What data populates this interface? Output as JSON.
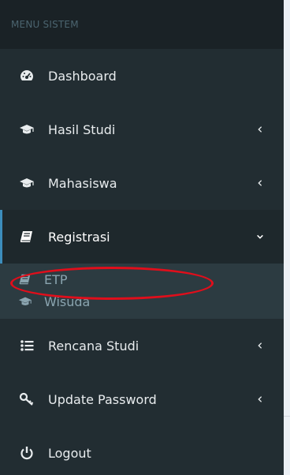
{
  "sidebar": {
    "header": "MENU SISTEM",
    "items": [
      {
        "label": "Dashboard",
        "icon": "dashboard-icon"
      },
      {
        "label": "Hasil Studi",
        "icon": "graduation-cap-icon",
        "chevron": "chevron-left-icon"
      },
      {
        "label": "Mahasiswa",
        "icon": "graduation-cap-icon",
        "chevron": "chevron-left-icon"
      },
      {
        "label": "Registrasi",
        "icon": "book-icon",
        "chevron": "chevron-down-icon",
        "expanded": true
      },
      {
        "label": "Rencana Studi",
        "icon": "list-icon",
        "chevron": "chevron-left-icon"
      },
      {
        "label": "Update Password",
        "icon": "key-icon",
        "chevron": "chevron-left-icon"
      },
      {
        "label": "Logout",
        "icon": "power-icon"
      }
    ],
    "registrasi_submenu": [
      {
        "label": "ETP",
        "icon": "book-icon"
      },
      {
        "label": "Wisuda",
        "icon": "graduation-cap-icon"
      }
    ]
  },
  "colors": {
    "sidebar_bg": "#222d32",
    "header_bg": "#1a2226",
    "active_bg": "#1e282c",
    "active_border": "#3c8dbc",
    "submenu_bg": "#2c3b41",
    "annotation": "#e00e1b"
  }
}
